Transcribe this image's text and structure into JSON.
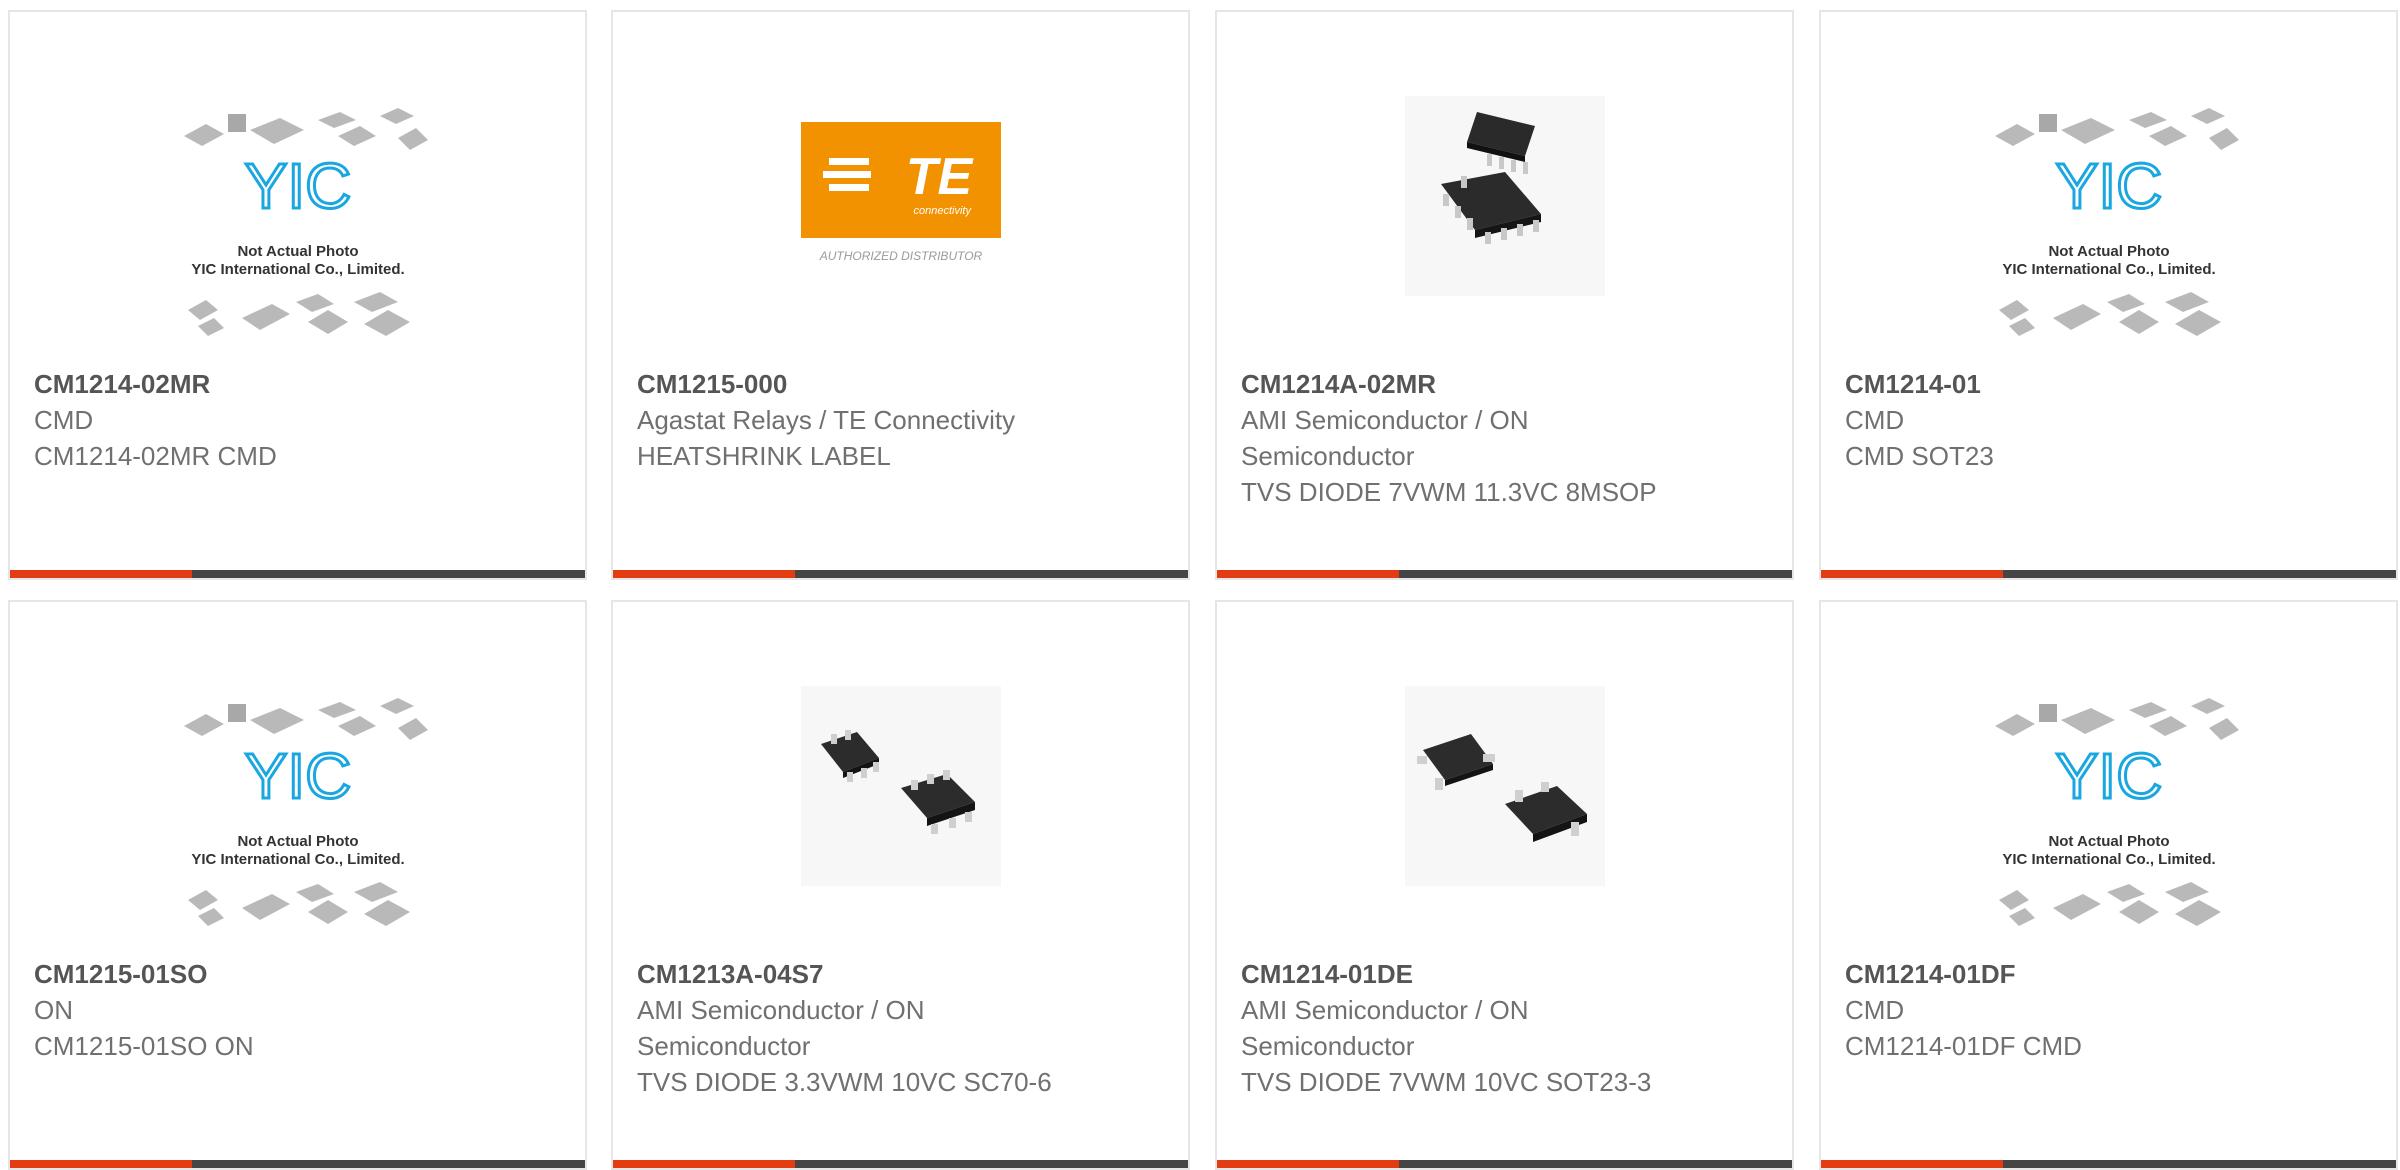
{
  "colors": {
    "accent": "#e33b12",
    "bar": "#454545",
    "part_number": "#555555",
    "text": "#707070",
    "te_orange": "#f39200",
    "yic_blue": "#1aa7e0"
  },
  "placeholder": {
    "line1": "Not Actual Photo",
    "line2": "YIC International Co., Limited.",
    "logo": "YIC"
  },
  "te_logo": {
    "brand": "TE",
    "tagline": "connectivity",
    "caption": "AUTHORIZED DISTRIBUTOR"
  },
  "products": [
    {
      "part_number": "CM1214-02MR",
      "manufacturer": "CMD",
      "description": "CM1214-02MR CMD",
      "image": "yic-placeholder"
    },
    {
      "part_number": "CM1215-000",
      "manufacturer": "Agastat Relays / TE Connectivity",
      "description": "HEATSHRINK LABEL",
      "image": "te-logo"
    },
    {
      "part_number": "CM1214A-02MR",
      "manufacturer": "AMI Semiconductor / ON Semiconductor",
      "description": "TVS DIODE 7VWM 11.3VC 8MSOP",
      "image": "msop8-chip"
    },
    {
      "part_number": "CM1214-01",
      "manufacturer": "CMD",
      "description": "CMD SOT23",
      "image": "yic-placeholder"
    },
    {
      "part_number": "CM1215-01SO",
      "manufacturer": "ON",
      "description": "CM1215-01SO ON",
      "image": "yic-placeholder"
    },
    {
      "part_number": "CM1213A-04S7",
      "manufacturer": "AMI Semiconductor / ON Semiconductor",
      "description": "TVS DIODE 3.3VWM 10VC SC70-6",
      "image": "sc70-chip"
    },
    {
      "part_number": "CM1214-01DE",
      "manufacturer": "AMI Semiconductor / ON Semiconductor",
      "description": "TVS DIODE 7VWM 10VC SOT23-3",
      "image": "sot23-chip"
    },
    {
      "part_number": "CM1214-01DF",
      "manufacturer": "CMD",
      "description": "CM1214-01DF CMD",
      "image": "yic-placeholder"
    }
  ]
}
